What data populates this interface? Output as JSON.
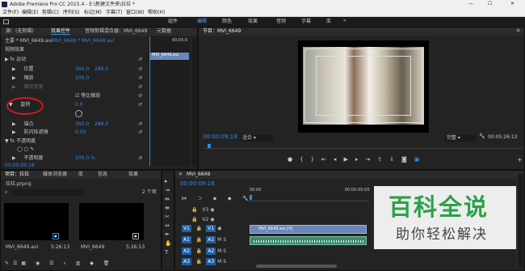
{
  "window": {
    "title": "Adobe Premiere Pro CC 2015.4 - E:\\新建文件夹\\拉拉 *",
    "controls": [
      "—",
      "☐",
      "✕"
    ]
  },
  "menu": [
    "文件(F)",
    "编辑(E)",
    "剪辑(C)",
    "序列(S)",
    "标记(M)",
    "字幕(T)",
    "窗口(W)",
    "帮助(H)"
  ],
  "workspaces": [
    "组件",
    "编辑",
    "颜色",
    "效果",
    "音频",
    "字幕",
    "库"
  ],
  "effect_controls": {
    "tabs": [
      "源：(无剪辑)",
      "效果控件",
      "音频剪辑混合器：MVI_6649",
      "元数据"
    ],
    "clip_path": "主要 * MVI_6649.avi",
    "seq_path": "MVI_6649 * MVI_6649.avi",
    "section": "视频效果",
    "mini_clip": "MVI_6649.avi",
    "mini_time": "00;05;0",
    "rows": [
      {
        "label": "fx 运动"
      },
      {
        "label": "位置",
        "v1": "360.0",
        "v2": "288.0"
      },
      {
        "label": "缩放",
        "v1": "100.0"
      },
      {
        "label": "缩放宽度",
        "v1": ""
      },
      {
        "label": "等比缩放"
      },
      {
        "label": "旋转",
        "v1": "0.0"
      },
      {
        "label": "锚点",
        "v1": "360.0",
        "v2": "288.0"
      },
      {
        "label": "防闪烁滤镜",
        "v1": "0.00"
      },
      {
        "label": "fx 不透明度"
      },
      {
        "label": "不透明度",
        "v1": "100.0 %"
      }
    ],
    "timecode": "00:00:09:18"
  },
  "program": {
    "tab": "节目：MVI_6649",
    "timecode": "00:00:09:18",
    "fit": "适合",
    "quality": "完整",
    "duration": "00:05:26:13"
  },
  "project": {
    "tabs": [
      "项目：拉拉",
      "媒体浏览器",
      "库",
      "信息",
      "效果"
    ],
    "name": "拉拉.prproj",
    "count": "2 个项",
    "items": [
      {
        "name": "MVI_6649.avi",
        "dur": "5:26:13"
      },
      {
        "name": "MVI_6649",
        "dur": "5:26:13"
      }
    ]
  },
  "timeline": {
    "tab": "MVI_6649",
    "timecode": "00:00:09:18",
    "ruler": [
      "00:00",
      "00:00:05:00"
    ],
    "video_tracks": [
      "V3",
      "V2",
      "V1"
    ],
    "audio_tracks": [
      "A1",
      "A2",
      "A3"
    ],
    "clip_v": "MVI_6649.avi [V]",
    "clip_a": ""
  },
  "watermark": {
    "line1": "百科全说",
    "line2": "助你轻松解决"
  }
}
